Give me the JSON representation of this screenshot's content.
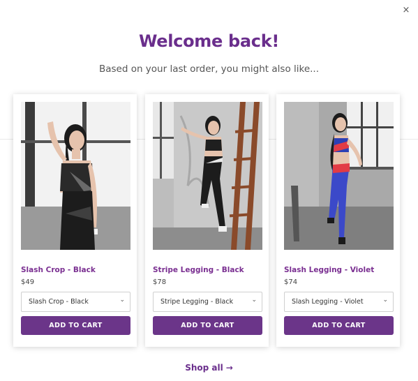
{
  "modal": {
    "close_symbol": "×",
    "title": "Welcome back!",
    "subtitle": "Based on your last order, you might also like...",
    "shop_all_label": "Shop all",
    "shop_all_arrow": "→"
  },
  "colors": {
    "brand_purple": "#6a2e8c",
    "button_purple": "#6b3589"
  },
  "products": [
    {
      "name": "Slash Crop - Black",
      "price": "$49",
      "selected_option": "Slash Crop - Black",
      "add_to_cart_label": "ADD TO CART",
      "image": "woman-in-black-sports-bra"
    },
    {
      "name": "Stripe Legging - Black",
      "price": "$78",
      "selected_option": "Stripe Legging - Black",
      "add_to_cart_label": "ADD TO CART",
      "image": "woman-in-black-leggings-with-ladder"
    },
    {
      "name": "Slash Legging - Violet",
      "price": "$74",
      "selected_option": "Slash Legging - Violet",
      "add_to_cart_label": "ADD TO CART",
      "image": "woman-in-violet-leggings"
    }
  ]
}
